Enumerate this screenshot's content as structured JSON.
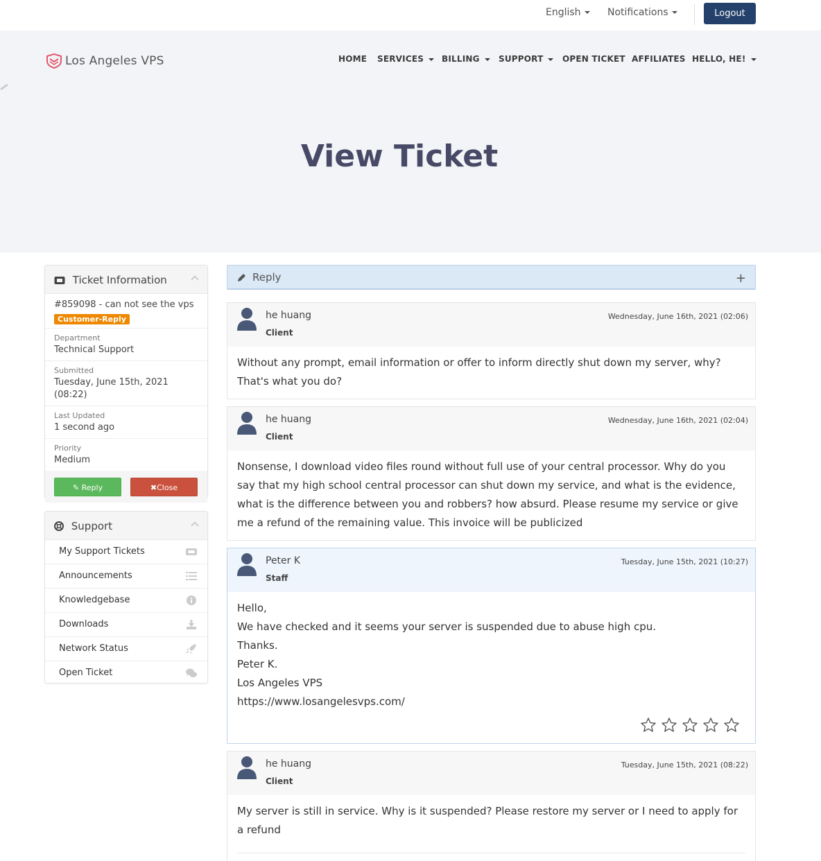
{
  "topbar": {
    "language": "English",
    "notifications": "Notifications",
    "logout": "Logout"
  },
  "header": {
    "brand": "Los Angeles VPS",
    "nav": [
      {
        "label": "HOME",
        "dropdown": false
      },
      {
        "label": "SERVICES",
        "dropdown": true
      },
      {
        "label": "BILLING",
        "dropdown": true
      },
      {
        "label": "SUPPORT",
        "dropdown": true
      },
      {
        "label": "OPEN TICKET",
        "dropdown": false
      },
      {
        "label": "AFFILIATES",
        "dropdown": false
      },
      {
        "label": "HELLO, HE!",
        "dropdown": true
      }
    ],
    "page_title": "View Ticket"
  },
  "ticket_info": {
    "title": "Ticket Information",
    "subject": "#859098 - can not see the vps",
    "status": "Customer-Reply",
    "status_color": "#ed8800",
    "department_label": "Department",
    "department": "Technical Support",
    "submitted_label": "Submitted",
    "submitted": "Tuesday, June 15th, 2021 (08:22)",
    "updated_label": "Last Updated",
    "updated": "1 second ago",
    "priority_label": "Priority",
    "priority": "Medium",
    "reply_button": "Reply",
    "close_button": "Close"
  },
  "support": {
    "title": "Support",
    "items": [
      {
        "label": "My Support Tickets",
        "icon": "ticket-icon"
      },
      {
        "label": "Announcements",
        "icon": "list-icon"
      },
      {
        "label": "Knowledgebase",
        "icon": "info-icon"
      },
      {
        "label": "Downloads",
        "icon": "download-icon"
      },
      {
        "label": "Network Status",
        "icon": "rocket-icon"
      },
      {
        "label": "Open Ticket",
        "icon": "comments-icon"
      }
    ]
  },
  "reply_bar": {
    "label": "Reply",
    "toggle": "+"
  },
  "messages": [
    {
      "author": "he huang",
      "role": "Client",
      "date": "Wednesday, June 16th, 2021 (02:06)",
      "lines": [
        "Without any prompt, email information or offer to inform directly shut down my server, why? That's what you do?"
      ]
    },
    {
      "author": "he huang",
      "role": "Client",
      "date": "Wednesday, June 16th, 2021 (02:04)",
      "lines": [
        "Nonsense, I download video files round without full use of your central processor. Why do you say that my high school central processor can shut down my service, and what is the evidence, what is the difference between you and robbers? how absurd. Please resume my service or give me a refund of the remaining value. This invoice will be publicized"
      ]
    },
    {
      "author": "Peter K",
      "role": "Staff",
      "date": "Tuesday, June 15th, 2021 (10:27)",
      "lines": [
        "Hello,",
        "We have checked and it seems your server is suspended due to abuse high cpu.",
        "Thanks.",
        "Peter K.",
        "Los Angeles VPS",
        "https://www.losangelesvps.com/"
      ],
      "rating": 0,
      "rating_max": 5
    },
    {
      "author": "he huang",
      "role": "Client",
      "date": "Tuesday, June 15th, 2021 (08:22)",
      "lines": [
        "My server is still in service. Why is it suspended? Please restore my server or I need to apply for a refund"
      ]
    }
  ],
  "colors": {
    "primary": "#23416b",
    "hero_bg": "#f2f4f7",
    "title": "#474966",
    "success": "#5cb85c",
    "danger": "#c9513d"
  }
}
